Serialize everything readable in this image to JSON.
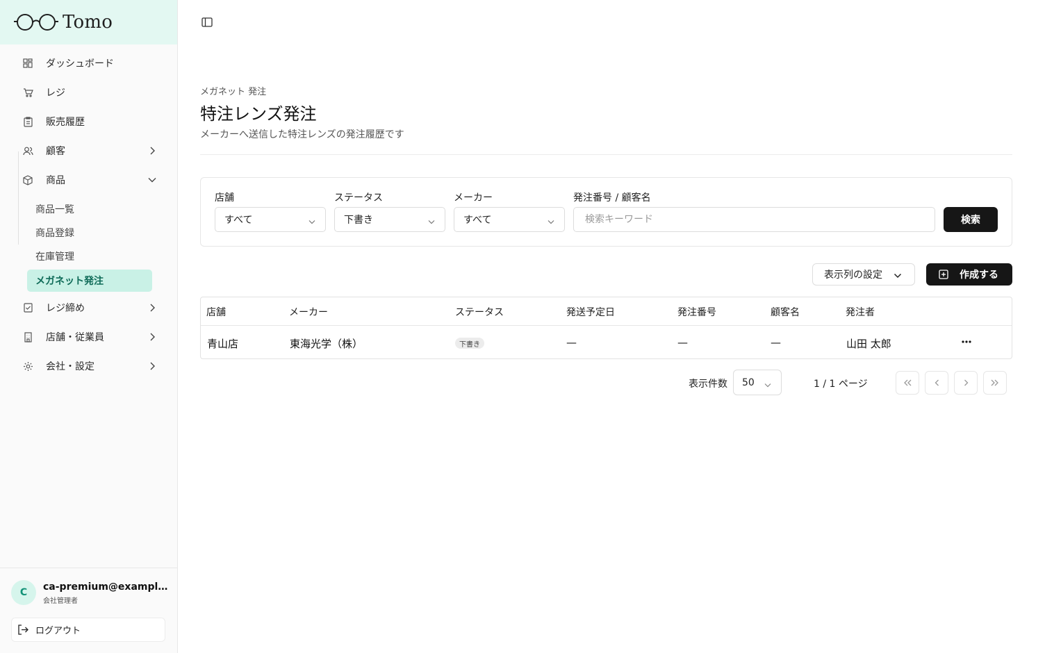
{
  "app": {
    "logo_text": "Tomo",
    "accent": "#0f6b58",
    "logo_bg": "#e3f8f2"
  },
  "sidebar": {
    "items": [
      {
        "label": "ダッシュボード",
        "icon": "dashboard-icon"
      },
      {
        "label": "レジ",
        "icon": "cart-icon"
      },
      {
        "label": "販売履歴",
        "icon": "clipboard-icon"
      },
      {
        "label": "顧客",
        "icon": "users-icon",
        "expandable": true
      },
      {
        "label": "商品",
        "icon": "package-icon",
        "expanded": true
      },
      {
        "label": "レジ締め",
        "icon": "checklist-icon",
        "expandable": true
      },
      {
        "label": "店舗・従業員",
        "icon": "building-icon",
        "expandable": true
      },
      {
        "label": "会社・設定",
        "icon": "gear-icon",
        "expandable": true
      }
    ],
    "product_sub": [
      {
        "label": "商品一覧"
      },
      {
        "label": "商品登録"
      },
      {
        "label": "在庫管理"
      },
      {
        "label": "メガネット発注",
        "active": true
      }
    ],
    "user": {
      "initial": "C",
      "email": "ca-premium@example.com",
      "role": "会社管理者"
    },
    "logout_label": "ログアウト"
  },
  "page": {
    "breadcrumb": "メガネット 発注",
    "title": "特注レンズ発注",
    "subtitle": "メーカーへ送信した特注レンズの発注履歴です"
  },
  "filters": {
    "store": {
      "label": "店舗",
      "value": "すべて"
    },
    "status": {
      "label": "ステータス",
      "value": "下書き"
    },
    "maker": {
      "label": "メーカー",
      "value": "すべて"
    },
    "keyword": {
      "label": "発注番号 / 顧客名",
      "placeholder": "検索キーワード"
    },
    "search_label": "検索"
  },
  "toolbar": {
    "columns_label": "表示列の設定",
    "create_label": "作成する"
  },
  "table": {
    "headers": [
      "店舗",
      "メーカー",
      "ステータス",
      "発送予定日",
      "発注番号",
      "顧客名",
      "発注者"
    ],
    "rows": [
      {
        "store": "青山店",
        "maker": "東海光学（株）",
        "status": "下書き",
        "ship_date": "—",
        "order_no": "—",
        "customer": "—",
        "orderer": "山田 太郎"
      }
    ]
  },
  "pagination": {
    "per_page_label": "表示件数",
    "per_page": "50",
    "page_info": "1 / 1 ページ"
  }
}
